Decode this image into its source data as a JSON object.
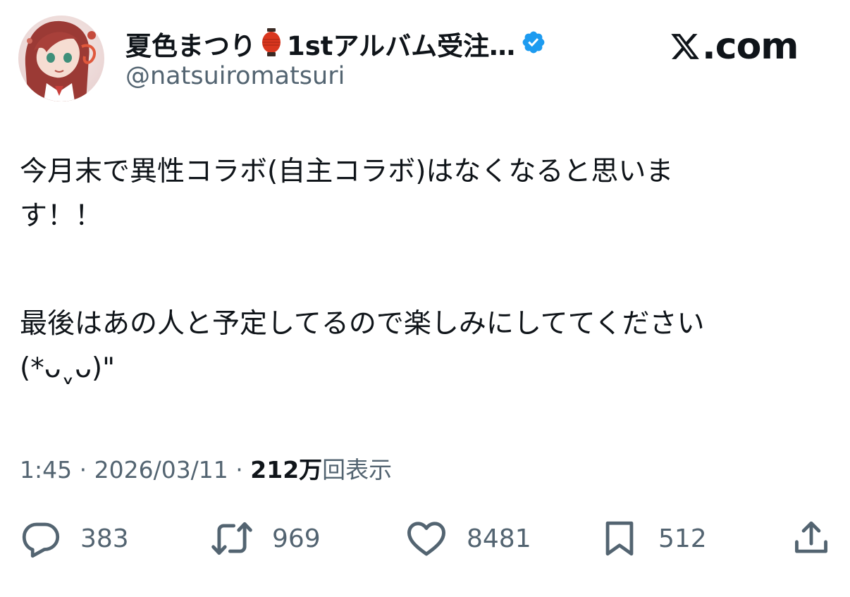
{
  "header": {
    "display_name": "夏色まつり",
    "display_name_suffix": "1stアルバム受注…",
    "handle": "@natsuiromatsuri",
    "site_logo_text": ".com"
  },
  "tweet": {
    "paragraph1": "今月末で異性コラボ(自主コラボ)はなくなると思いま\nす！！",
    "paragraph2": "最後はあの人と予定してるので楽しみにしててください\n(*ᴗˬᴗ)\""
  },
  "meta": {
    "time": "1:45",
    "date": "2026/03/11",
    "views_count": "212万",
    "views_label": "回表示"
  },
  "actions": {
    "reply_count": "383",
    "retweet_count": "969",
    "like_count": "8481",
    "bookmark_count": "512"
  },
  "colors": {
    "text_primary": "#0f1419",
    "text_secondary": "#536471",
    "verified": "#1d9bf0",
    "lantern": "#d9371f"
  },
  "icons": {
    "reply": "reply-icon",
    "retweet": "retweet-icon",
    "like": "like-icon",
    "bookmark": "bookmark-icon",
    "share": "share-icon",
    "verified": "verified-badge-icon",
    "lantern": "lantern-emoji-icon",
    "x_logo": "x-logo-icon"
  }
}
